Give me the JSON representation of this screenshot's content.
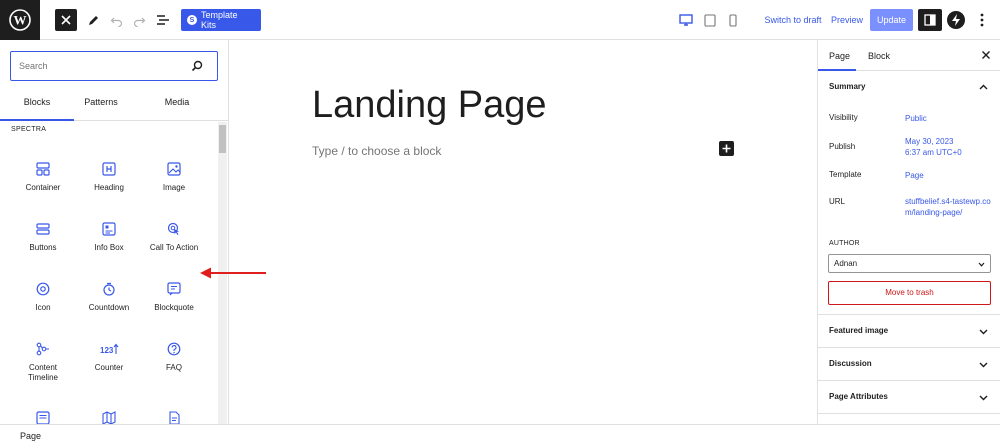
{
  "toolbar": {
    "template_kits_label": "Template Kits",
    "switch_to_draft_label": "Switch to draft",
    "preview_label": "Preview",
    "update_label": "Update"
  },
  "inserter": {
    "search_placeholder": "Search",
    "tabs": [
      "Blocks",
      "Patterns",
      "Media"
    ],
    "category": "SPECTRA",
    "blocks": [
      {
        "label": "Container",
        "icon": "container-icon"
      },
      {
        "label": "Heading",
        "icon": "heading-icon"
      },
      {
        "label": "Image",
        "icon": "image-icon"
      },
      {
        "label": "Buttons",
        "icon": "buttons-icon"
      },
      {
        "label": "Info Box",
        "icon": "info-box-icon"
      },
      {
        "label": "Call To Action",
        "icon": "call-to-action-icon"
      },
      {
        "label": "Icon",
        "icon": "icon-block-icon"
      },
      {
        "label": "Countdown",
        "icon": "countdown-icon"
      },
      {
        "label": "Blockquote",
        "icon": "blockquote-icon"
      },
      {
        "label": "Content\nTimeline",
        "icon": "content-timeline-icon"
      },
      {
        "label": "Counter",
        "icon": "counter-icon"
      },
      {
        "label": "FAQ",
        "icon": "faq-icon"
      }
    ]
  },
  "canvas": {
    "title": "Landing Page",
    "placeholder": "Type / to choose a block"
  },
  "sidebar": {
    "tabs": [
      "Page",
      "Block"
    ],
    "summary_title": "Summary",
    "visibility_label": "Visibility",
    "visibility_value": "Public",
    "publish_label": "Publish",
    "publish_value": "May 30, 2023\n6:37 am UTC+0",
    "template_label": "Template",
    "template_value": "Page",
    "url_label": "URL",
    "url_value": "stuffbelief.s4-tastewp.com/landing-page/",
    "author_label": "AUTHOR",
    "author_value": "Adnan",
    "move_to_trash_label": "Move to trash",
    "featured_image_title": "Featured image",
    "discussion_title": "Discussion",
    "page_attributes_title": "Page Attributes"
  },
  "footer": {
    "breadcrumb": "Page"
  },
  "colors": {
    "accent": "#3858e9",
    "update_button": "#7b90ff",
    "danger": "#cc1818",
    "annotation_arrow": "#e01e1e",
    "dark": "#1e1e1e"
  }
}
